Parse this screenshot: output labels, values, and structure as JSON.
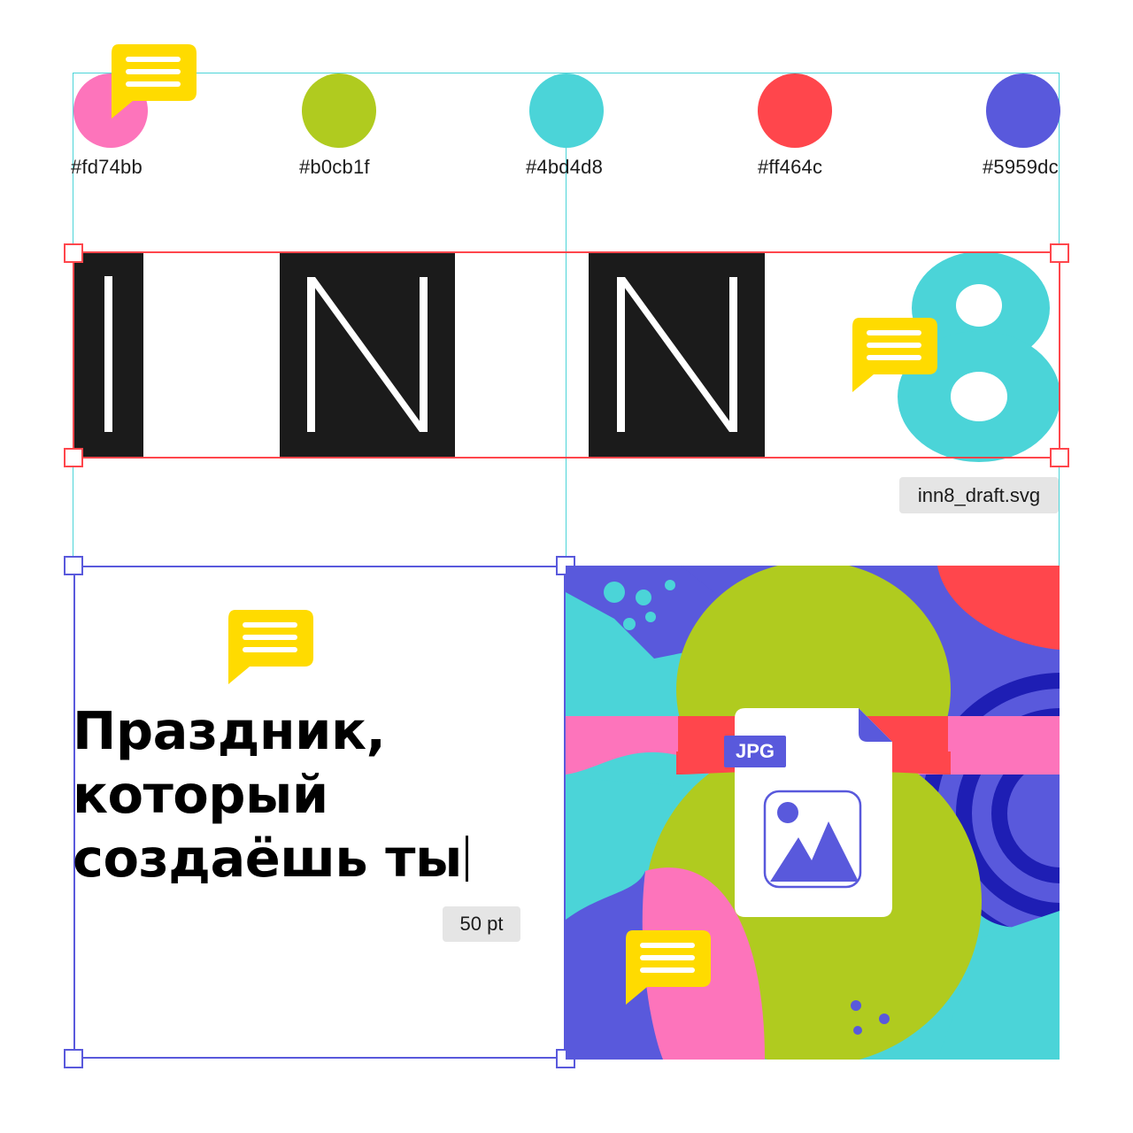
{
  "palette": [
    {
      "hex": "#fd74bb"
    },
    {
      "hex": "#b0cb1f"
    },
    {
      "hex": "#4bd4d8"
    },
    {
      "hex": "#ff464c"
    },
    {
      "hex": "#5959dc"
    }
  ],
  "logo": {
    "letters": [
      "I",
      "N",
      "N",
      "8"
    ],
    "letter_color": "#1b1b1b",
    "eight_color": "#4bd4d8",
    "file_chip": "inn8_draft.svg"
  },
  "text_block": {
    "lines": [
      "Праздник,",
      "который",
      "создаёшь ты"
    ],
    "size_chip": "50 pt"
  },
  "image_card": {
    "badge": "JPG"
  },
  "colors": {
    "selection_red": "#ff464c",
    "selection_blue": "#5959dc",
    "guide": "#4bd4d8",
    "comment": "#ffdb00",
    "chip_bg": "#e5e5e5"
  },
  "icons": [
    "comment-icon",
    "image-icon",
    "file-icon"
  ]
}
